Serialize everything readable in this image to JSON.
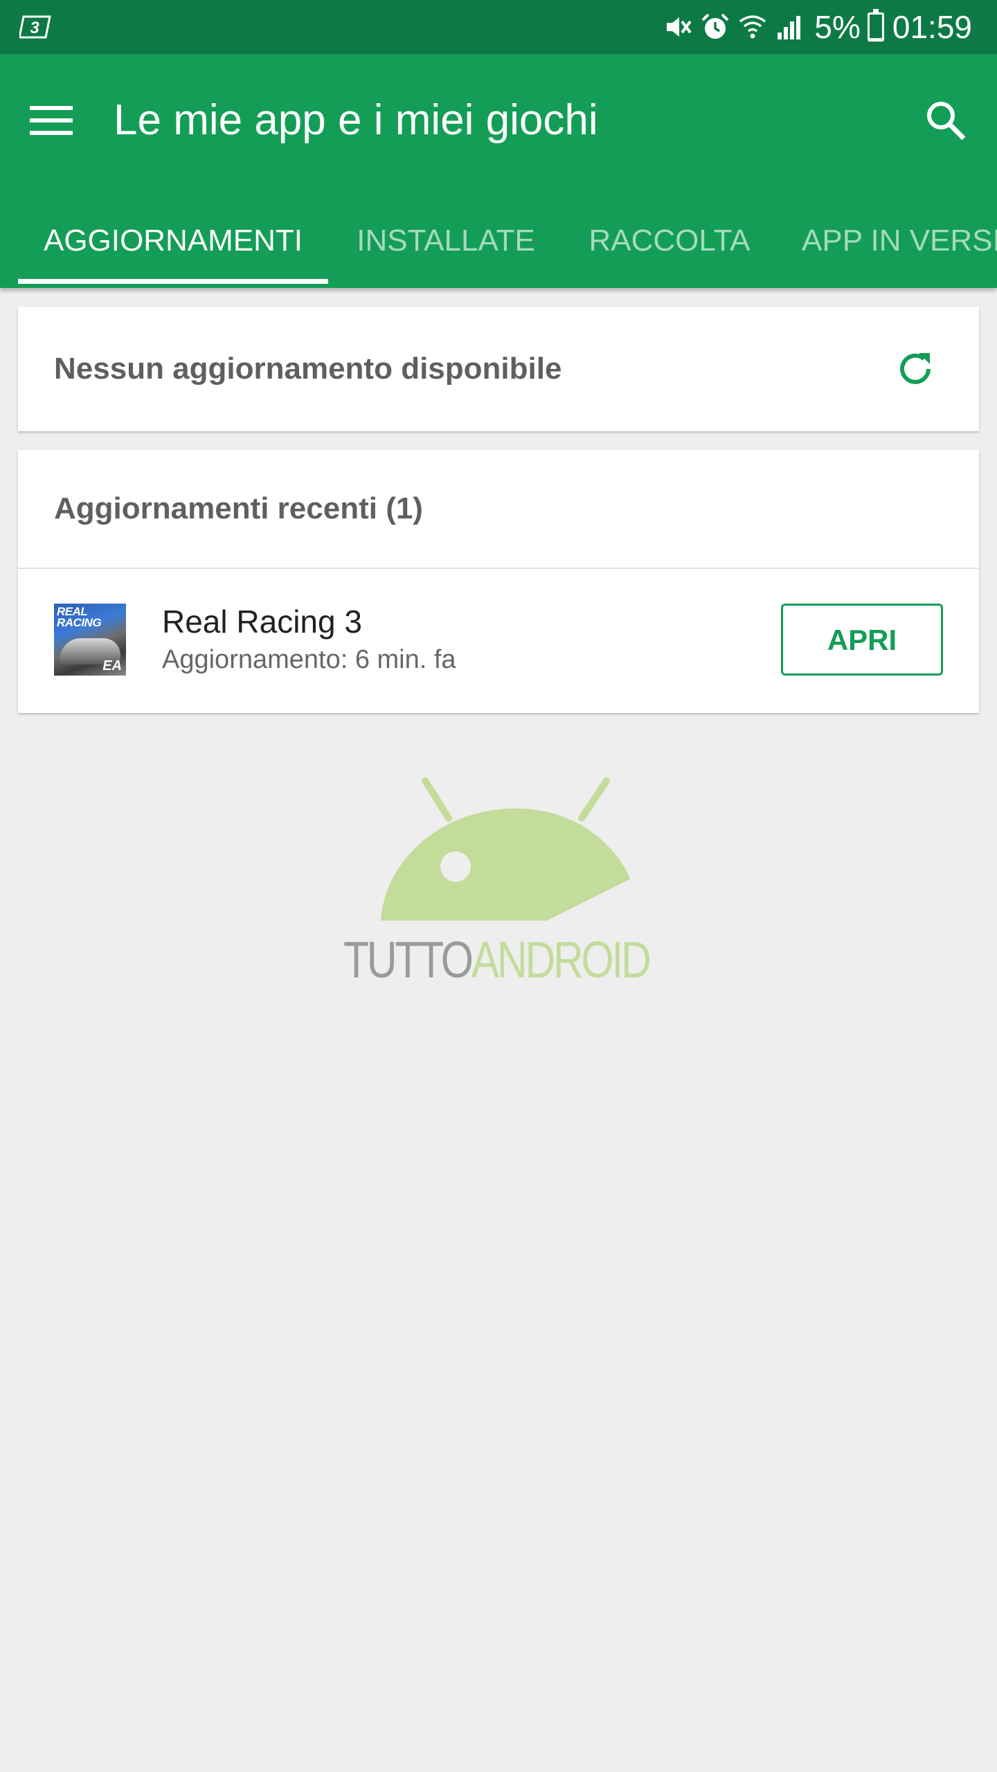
{
  "status_bar": {
    "carrier": "3",
    "battery_percent": "5%",
    "time": "01:59",
    "battery_level": 0.05,
    "icons": [
      "mute-icon",
      "alarm-icon",
      "wifi-icon",
      "signal-icon",
      "battery-icon"
    ]
  },
  "app_bar": {
    "title": "Le mie app e i miei giochi",
    "menu_icon": "hamburger-menu-icon",
    "search_icon": "search-icon",
    "background": "#149d56",
    "status_background": "#0d7a45"
  },
  "tabs": [
    {
      "label": "AGGIORNAMENTI",
      "active": true
    },
    {
      "label": "INSTALLATE",
      "active": false
    },
    {
      "label": "RACCOLTA",
      "active": false
    },
    {
      "label": "APP IN VERSI",
      "active": false
    }
  ],
  "no_updates_card": {
    "message": "Nessun aggiornamento disponibile",
    "refresh_icon": "refresh-icon"
  },
  "recent_updates": {
    "header": "Aggiornamenti recenti (1)",
    "items": [
      {
        "name": "Real Racing 3",
        "subtitle": "Aggiornamento: 6 min. fa",
        "icon_label_top": "REAL RACING",
        "icon_label_brand": "EA",
        "action": "APRI"
      }
    ]
  },
  "watermark": {
    "part_a": "TUTTO",
    "part_b": "ANDROID"
  },
  "colors": {
    "accent": "#149d56",
    "background": "#eeeeee",
    "watermark_green": "#c3dc9a",
    "watermark_gray": "#9a9a9a"
  }
}
